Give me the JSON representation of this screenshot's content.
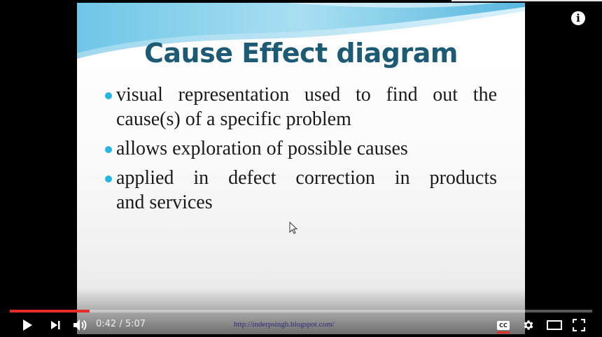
{
  "slide": {
    "title": "Cause Effect diagram",
    "bullets": [
      {
        "lines": [
          "visual representation used to find out the",
          "cause(s) of a specific problem"
        ]
      },
      {
        "lines": [
          "allows exploration of possible causes"
        ]
      },
      {
        "lines": [
          "applied in defect correction in products",
          "and services"
        ]
      }
    ],
    "footer_url": "http://inderpsingh.blogspot.com/"
  },
  "player": {
    "current_time": "0:42",
    "time_separator": " / ",
    "duration": "5:07",
    "progress_played": 0.137,
    "progress_loaded": 0.137,
    "cc_label": "CC",
    "info_label": "i",
    "accent_color": "#e52d27",
    "icons": [
      "play-icon",
      "next-icon",
      "volume-icon",
      "cc-icon",
      "settings-icon",
      "theater-mode-icon",
      "fullscreen-icon",
      "info-icon"
    ]
  }
}
